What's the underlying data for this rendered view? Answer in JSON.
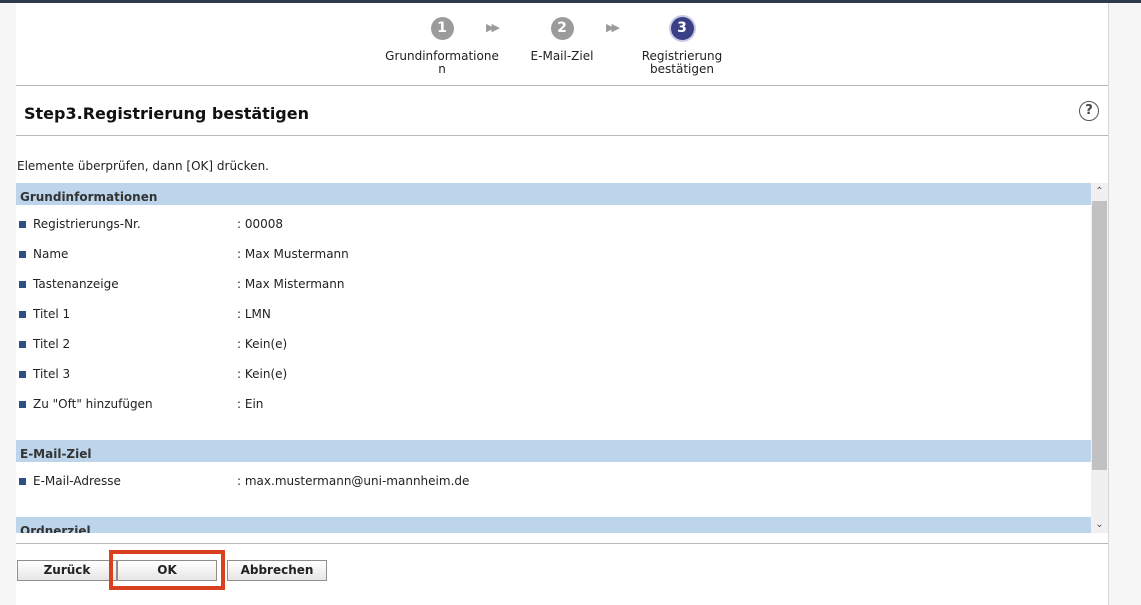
{
  "steps": [
    {
      "number": "1",
      "label": "Grundinformationen"
    },
    {
      "number": "2",
      "label": "E-Mail-Ziel"
    },
    {
      "number": "3",
      "label": "Registrierung bestätigen"
    }
  ],
  "step_arrow": "▶▶",
  "page_title": "Step3.Registrierung bestätigen",
  "help_icon": "?",
  "instruction": "Elemente überprüfen, dann [OK] drücken.",
  "sections": [
    {
      "header": "Grundinformationen",
      "rows": [
        {
          "label": "Registrierungs-Nr.",
          "value": ": 00008"
        },
        {
          "label": "Name",
          "value": ": Max Mustermann"
        },
        {
          "label": "Tastenanzeige",
          "value": ": Max Mistermann"
        },
        {
          "label": "Titel 1",
          "value": ": LMN"
        },
        {
          "label": "Titel 2",
          "value": ": Kein(e)"
        },
        {
          "label": "Titel 3",
          "value": ": Kein(e)"
        },
        {
          "label": "Zu \"Oft\" hinzufügen",
          "value": ": Ein"
        }
      ]
    },
    {
      "header": "E-Mail-Ziel",
      "rows": [
        {
          "label": "E-Mail-Adresse",
          "value": ": max.mustermann@uni-mannheim.de"
        }
      ]
    },
    {
      "header": "Ordnerziel",
      "rows": []
    }
  ],
  "scroll_up": "⌃",
  "scroll_down": "⌄",
  "buttons": {
    "back": "Zurück",
    "ok": "OK",
    "cancel": "Abbrechen"
  },
  "colors": {
    "section_header_bg": "#bcd5ea",
    "active_step": "#3b3f86",
    "inactive_step": "#9b9b9b",
    "highlight": "#d9401f",
    "bullet": "#2e4f85"
  }
}
